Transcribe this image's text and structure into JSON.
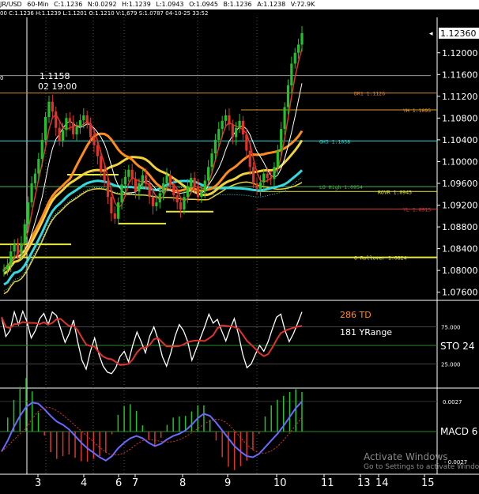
{
  "header": {
    "symbol": "JR/USD",
    "timeframe": "60-Min",
    "fields": [
      "C:1.1236",
      "N:0.0292",
      "H:1.1239",
      "L:1.0943",
      "O:1.0945",
      "B:1.1236",
      "A:1.1238",
      "V:72.9K"
    ],
    "sub": "00  C:1.1236  H:1.1239  L:1.1201  O:1.1210  V:1,679  S:1.0787  04-10-25  33:52"
  },
  "watermark": {
    "title": "Activate Windows",
    "subtitle": "Go to Settings to activate Windows."
  },
  "chart_data": [
    {
      "type": "line",
      "panel": "price",
      "xlabels": [
        "3",
        "4",
        "6",
        "7",
        "8",
        "9",
        "10",
        "11",
        "13",
        "14",
        "15"
      ],
      "ytick_labels": [
        "1.12000",
        "1.11600",
        "1.11200",
        "1.10800",
        "1.10400",
        "1.10000",
        "1.09600",
        "1.09200",
        "1.08800",
        "1.08400",
        "1.08000",
        "1.07600"
      ],
      "ylim": [
        1.0745,
        1.1265
      ],
      "last_price": "1.12360",
      "crosshair_label": [
        "1.1158",
        "02 19:00"
      ],
      "left_tick": "0",
      "close_series": [
        1.0802,
        1.081,
        1.0835,
        1.0848,
        1.083,
        1.085,
        1.0885,
        1.0925,
        1.096,
        1.0978,
        1.1005,
        1.104,
        1.1082,
        1.111,
        1.1092,
        1.1062,
        1.1038,
        1.1058,
        1.108,
        1.1072,
        1.105,
        1.1064,
        1.1076,
        1.1085,
        1.107,
        1.1045,
        1.103,
        1.101,
        1.098,
        1.0965,
        1.0935,
        1.0905,
        1.0895,
        1.0925,
        1.0958,
        1.0972,
        1.0985,
        1.0968,
        1.0945,
        1.096,
        1.0975,
        1.096,
        1.0935,
        1.0918,
        1.0925,
        1.0942,
        1.096,
        1.0975,
        1.0958,
        1.0938,
        1.0925,
        1.0912,
        1.0935,
        1.0955,
        1.097,
        1.0955,
        1.0935,
        1.0945,
        1.0965,
        1.099,
        1.1015,
        1.104,
        1.106,
        1.1075,
        1.1085,
        1.1068,
        1.1045,
        1.1062,
        1.1075,
        1.105,
        1.102,
        1.099,
        1.096,
        1.095,
        1.0962,
        1.0978,
        1.097,
        1.0968,
        1.099,
        1.102,
        1.106,
        1.11,
        1.114,
        1.118,
        1.12,
        1.1215,
        1.1236
      ],
      "hlines": [
        {
          "label": "DR1  1.1126",
          "value": 1.1126,
          "color": "#d08a3a"
        },
        {
          "label": "YH  1.1095",
          "value": 1.1095,
          "color": "#e09b2d"
        },
        {
          "label": "OH3  1.1038",
          "value": 1.1038,
          "color": "#32d6d6"
        },
        {
          "label": "LO High  1.0954",
          "value": 1.0954,
          "color": "#4caf50"
        },
        {
          "label": "ROVR  1.0945",
          "value": 1.0945,
          "color": "#e8e83a"
        },
        {
          "label": "YL  1.0913",
          "value": 1.0913,
          "color": "#d23c3c"
        },
        {
          "label": "O Rollover  1.0824",
          "value": 1.0824,
          "color": "#e8e83a"
        }
      ],
      "colors": {
        "up": "#22c32a",
        "down": "#e0342a",
        "ma_fast": "#e0342a",
        "ma_white": "#ffffff",
        "ma_orange": "#ff8c1a",
        "ma_yellow": "#f0d23a",
        "ma_cyan": "#34d8e0",
        "ma_long": "#e8d23a"
      }
    },
    {
      "type": "line",
      "panel": "stochastic",
      "label": "STO 24",
      "ytick_labels": [
        "75.000",
        "25.000"
      ],
      "annotations": [
        "286 TD",
        "181 YRange"
      ],
      "k_series": [
        88,
        62,
        70,
        95,
        78,
        96,
        82,
        60,
        70,
        86,
        93,
        78,
        95,
        90,
        72,
        54,
        66,
        84,
        55,
        30,
        18,
        42,
        60,
        38,
        22,
        14,
        12,
        20,
        35,
        42,
        28,
        50,
        68,
        55,
        40,
        62,
        75,
        58,
        35,
        22,
        40,
        62,
        78,
        70,
        55,
        30,
        45,
        60,
        75,
        92,
        80,
        85,
        70,
        56,
        72,
        86,
        65,
        38,
        20,
        25,
        38,
        50,
        42,
        55,
        72,
        88,
        92,
        70,
        55,
        66,
        80,
        95
      ]
    },
    {
      "type": "line",
      "panel": "macd",
      "label": "MACD 6",
      "ytick_labels": [
        "0.0027",
        "0.0027"
      ],
      "macd_series": [
        -0.0018,
        -0.0008,
        0.0004,
        0.0014,
        0.0022,
        0.0026,
        0.0025,
        0.002,
        0.0014,
        0.0009,
        0.0006,
        0.0002,
        -0.0004,
        -0.001,
        -0.0015,
        -0.0019,
        -0.0023,
        -0.0026,
        -0.0022,
        -0.0015,
        -0.001,
        -0.0006,
        -0.0004,
        -0.0006,
        -0.001,
        -0.0013,
        -0.0011,
        -0.0007,
        -0.0004,
        -0.0002,
        0.0001,
        0.0006,
        0.0012,
        0.0016,
        0.0014,
        0.0008,
        0.0001,
        -0.0006,
        -0.0013,
        -0.0018,
        -0.0022,
        -0.0023,
        -0.002,
        -0.0014,
        -0.0008,
        -0.0002,
        0.0005,
        0.0013,
        0.0021,
        0.0027
      ]
    }
  ]
}
